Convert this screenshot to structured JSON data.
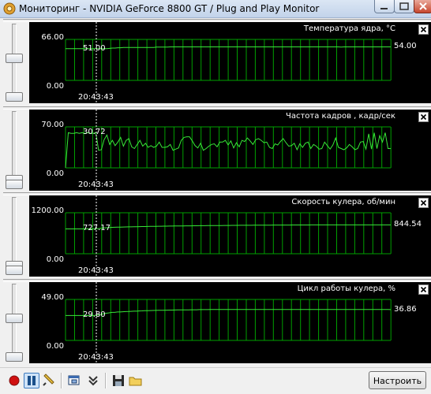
{
  "window": {
    "title": "Мониторинг - NVIDIA GeForce 8800 GT  / Plug and Play Monitor"
  },
  "panels": [
    {
      "title": "Температура ядра, °C",
      "y_max_label": "66.00",
      "y_min_label": "0.00",
      "cursor_value": "51.00",
      "current_value": "54.00",
      "time_label": "20:43:43",
      "slider_level": 0.55,
      "chart_data": {
        "type": "line",
        "ylim": [
          0,
          66
        ],
        "values": [
          51,
          51,
          51,
          51,
          51,
          51,
          51,
          51,
          51,
          51,
          51,
          51,
          51,
          51,
          51,
          51,
          51.5,
          52,
          52,
          52.5,
          52.5,
          53,
          53,
          53,
          53,
          53,
          53,
          53,
          53,
          53,
          53,
          53,
          53,
          53.5,
          53.5,
          53.5,
          53.5,
          53.5,
          54,
          54,
          54,
          54,
          54,
          54,
          54,
          54,
          54,
          54,
          54,
          54,
          54,
          54,
          54,
          54,
          54,
          54,
          54,
          54,
          54,
          54,
          54,
          54,
          54,
          54,
          54,
          54,
          54,
          54,
          54,
          54,
          54,
          54,
          54,
          54,
          54,
          54,
          54,
          54,
          54,
          54,
          54,
          54,
          54,
          54,
          54,
          54,
          54,
          54,
          54,
          54,
          54,
          54,
          54,
          54,
          54,
          54,
          54,
          54,
          54,
          54,
          53.5,
          54,
          54,
          54,
          54,
          54,
          54,
          54,
          54,
          54,
          54,
          54,
          54,
          54,
          54,
          54,
          54,
          54,
          54
        ]
      }
    },
    {
      "title": "Частота кадров , кадр/сек",
      "y_max_label": "70.00",
      "y_min_label": "0.00",
      "cursor_value": "30.72",
      "current_value": "",
      "time_label": "20:43:43",
      "slider_level": 0.05,
      "chart_data": {
        "type": "line",
        "ylim": [
          0,
          70
        ],
        "values": [
          0,
          60,
          59,
          59,
          60,
          59,
          60,
          59,
          60,
          59,
          59,
          60,
          30,
          31,
          48,
          56,
          40,
          47,
          38,
          44,
          52,
          37,
          47,
          50,
          36,
          33,
          40,
          47,
          37,
          42,
          35,
          38,
          35,
          37,
          44,
          35,
          35,
          36,
          40,
          30,
          32,
          34,
          47,
          52,
          53,
          53,
          46,
          38,
          34,
          42,
          30,
          33,
          37,
          40,
          41,
          36,
          44,
          44,
          47,
          39,
          46,
          34,
          43,
          36,
          47,
          45,
          51,
          46,
          40,
          48,
          50,
          47,
          43,
          44,
          35,
          33,
          41,
          39,
          45,
          50,
          43,
          37,
          38,
          42,
          31,
          41,
          35,
          42,
          44,
          33,
          40,
          37,
          32,
          33,
          44,
          38,
          32,
          39,
          51,
          35,
          33,
          31,
          34,
          40,
          36,
          31,
          33,
          44,
          45,
          32,
          58,
          32,
          60,
          33,
          55,
          44,
          60,
          33,
          33
        ]
      }
    },
    {
      "title": "Скорость кулера, об/мин",
      "y_max_label": "1200.00",
      "y_min_label": "0.00",
      "cursor_value": "727.17",
      "current_value": "844.54",
      "time_label": "20:43:43",
      "slider_level": 0.05,
      "chart_data": {
        "type": "line",
        "ylim": [
          0,
          1200
        ],
        "values": [
          727,
          727,
          727,
          727,
          727,
          727,
          727,
          727,
          727,
          727,
          727,
          730,
          735,
          745,
          755,
          762,
          768,
          772,
          775,
          778,
          780,
          782,
          784,
          786,
          788,
          790,
          792,
          794,
          796,
          797,
          798,
          800,
          802,
          804,
          805,
          806,
          807,
          808,
          810,
          811,
          812,
          813,
          814,
          815,
          816,
          817,
          818,
          819,
          820,
          821,
          822,
          822,
          823,
          824,
          825,
          826,
          826,
          827,
          828,
          829,
          829,
          830,
          831,
          831,
          832,
          833,
          833,
          834,
          834,
          835,
          836,
          836,
          837,
          837,
          838,
          838,
          839,
          839,
          840,
          840,
          841,
          841,
          841,
          842,
          842,
          842,
          843,
          843,
          843,
          843,
          844,
          844,
          844,
          844,
          844,
          844,
          844,
          844,
          844,
          844,
          844,
          844,
          844,
          844,
          844,
          844,
          844,
          844,
          844,
          844,
          844,
          844,
          844,
          844,
          844,
          844,
          844,
          844,
          844,
          844
        ]
      }
    },
    {
      "title": "Цикл работы кулера, %",
      "y_max_label": "49.00",
      "y_min_label": "0.00",
      "cursor_value": "29.80",
      "current_value": "36.86",
      "time_label": "20:43:43",
      "slider_level": 0.55,
      "chart_data": {
        "type": "line",
        "ylim": [
          0,
          49
        ],
        "values": [
          29.8,
          29.8,
          29.8,
          29.8,
          29.8,
          29.8,
          29.8,
          29.8,
          29.8,
          29.8,
          29.8,
          30,
          30.5,
          31,
          32,
          32.5,
          33,
          33.5,
          33.5,
          34,
          34,
          34.3,
          34.5,
          34.6,
          34.8,
          35,
          35,
          35.2,
          35.3,
          35.5,
          35.6,
          35.7,
          35.8,
          35.9,
          36,
          36,
          36.1,
          36.2,
          36.3,
          36.3,
          36.4,
          36.5,
          36.5,
          36.5,
          36.6,
          36.6,
          36.7,
          36.7,
          36.7,
          36.8,
          36.8,
          36.8,
          36.8,
          36.9,
          36.9,
          36.9,
          36.9,
          36.9,
          37,
          37,
          37,
          37,
          37,
          37,
          37,
          37,
          37,
          37,
          37,
          37,
          37,
          37,
          37,
          37,
          37,
          37,
          37,
          37,
          37,
          37,
          37,
          37,
          37,
          37,
          37,
          37,
          37,
          37,
          37,
          37,
          37,
          37,
          37,
          37,
          37,
          37,
          37,
          37,
          37,
          37,
          37,
          37,
          37,
          37,
          37,
          37,
          37,
          37,
          37,
          37,
          37,
          37,
          36.9,
          36.9,
          36.9,
          36.9,
          36.9,
          36.9,
          36.9,
          36.86
        ]
      }
    }
  ],
  "toolbar": {
    "record_icon": "record-icon",
    "pause_icon": "pause-icon",
    "setup_label": "Настроить"
  },
  "colors": {
    "graph_background": "#000000",
    "grid": "#00a000",
    "line": "#39e639",
    "cursor": "#ffffff"
  }
}
